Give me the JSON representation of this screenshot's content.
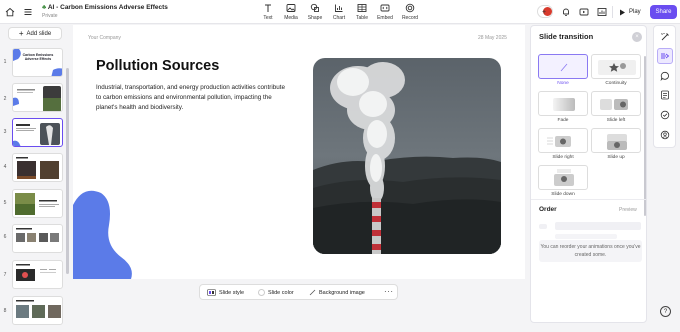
{
  "header": {
    "doc_title": "AI - Carbon Emissions Adverse Effects",
    "visibility": "Private",
    "tools": [
      {
        "label": "Text",
        "icon": "text-icon"
      },
      {
        "label": "Media",
        "icon": "media-icon"
      },
      {
        "label": "Shape",
        "icon": "shape-icon"
      },
      {
        "label": "Chart",
        "icon": "chart-icon"
      },
      {
        "label": "Table",
        "icon": "table-icon"
      },
      {
        "label": "Embed",
        "icon": "embed-icon"
      },
      {
        "label": "Record",
        "icon": "record-icon"
      }
    ],
    "play_label": "Play",
    "share_label": "Share"
  },
  "sidebar": {
    "add_slide_label": "Add slide",
    "active_index": 3,
    "thumbnails": [
      {
        "number": "1",
        "title": "Carbon Emissions Adverse Effects"
      },
      {
        "number": "2",
        "title": ""
      },
      {
        "number": "3",
        "title": "Pollution Sources"
      },
      {
        "number": "4",
        "title": ""
      },
      {
        "number": "5",
        "title": ""
      },
      {
        "number": "6",
        "title": ""
      },
      {
        "number": "7",
        "title": ""
      },
      {
        "number": "8",
        "title": ""
      }
    ]
  },
  "slide": {
    "company": "Your Company",
    "date": "28 May 2025",
    "heading": "Pollution Sources",
    "body": "Industrial, transportation, and energy production activities contribute to carbon emissions and environmental pollution, impacting the planet's health and biodiversity."
  },
  "bottom_bar": {
    "slide_style": "Slide style",
    "slide_color": "Slide color",
    "background_image": "Background image",
    "more": "···"
  },
  "transition_panel": {
    "title": "Slide transition",
    "options": [
      "None",
      "Continuity",
      "Fade",
      "Slide left",
      "Slide right",
      "Slide up",
      "Slide down"
    ],
    "selected": "None",
    "order_title": "Order",
    "preview_label": "Preview",
    "empty_message": "You can reorder your animations once you've created some."
  },
  "rail": {
    "icons": [
      "magic-icon",
      "transition-icon",
      "comment-icon",
      "notes-icon",
      "check-icon",
      "account-icon"
    ],
    "active": "transition-icon"
  },
  "colors": {
    "accent": "#6a4df0",
    "blob": "#5b7be8",
    "record": "#d83a2c"
  }
}
